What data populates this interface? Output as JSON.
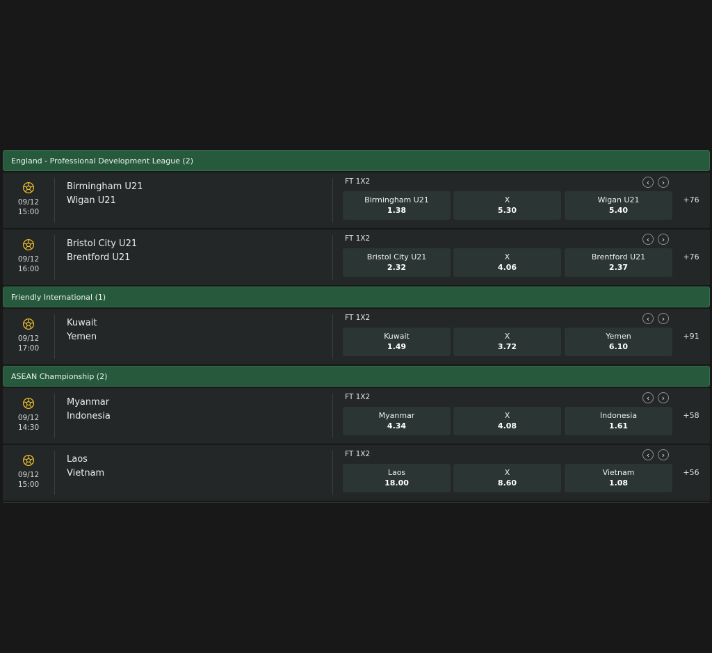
{
  "market_label": "FT 1X2",
  "draw_label": "X",
  "colors": {
    "accent": "#f2c02e",
    "header_bg": "#275a3d",
    "row_bg": "#232727",
    "odd_bg": "#2b3533"
  },
  "icons": {
    "sport": "soccer-ball-icon",
    "prev": "chevron-left-icon",
    "next": "chevron-right-icon"
  },
  "leagues": [
    {
      "title": "England - Professional Development League (2)",
      "events": [
        {
          "date": "09/12",
          "time": "15:00",
          "home": "Birmingham U21",
          "away": "Wigan U21",
          "odds": [
            {
              "label": "Birmingham U21",
              "value": "1.38"
            },
            {
              "label": "X",
              "value": "5.30"
            },
            {
              "label": "Wigan U21",
              "value": "5.40"
            }
          ],
          "more": "+76"
        },
        {
          "date": "09/12",
          "time": "16:00",
          "home": "Bristol City U21",
          "away": "Brentford U21",
          "odds": [
            {
              "label": "Bristol City U21",
              "value": "2.32"
            },
            {
              "label": "X",
              "value": "4.06"
            },
            {
              "label": "Brentford U21",
              "value": "2.37"
            }
          ],
          "more": "+76"
        }
      ]
    },
    {
      "title": "Friendly International (1)",
      "events": [
        {
          "date": "09/12",
          "time": "17:00",
          "home": "Kuwait",
          "away": "Yemen",
          "odds": [
            {
              "label": "Kuwait",
              "value": "1.49"
            },
            {
              "label": "X",
              "value": "3.72"
            },
            {
              "label": "Yemen",
              "value": "6.10"
            }
          ],
          "more": "+91"
        }
      ]
    },
    {
      "title": "ASEAN Championship (2)",
      "events": [
        {
          "date": "09/12",
          "time": "14:30",
          "home": "Myanmar",
          "away": "Indonesia",
          "odds": [
            {
              "label": "Myanmar",
              "value": "4.34"
            },
            {
              "label": "X",
              "value": "4.08"
            },
            {
              "label": "Indonesia",
              "value": "1.61"
            }
          ],
          "more": "+58"
        },
        {
          "date": "09/12",
          "time": "15:00",
          "home": "Laos",
          "away": "Vietnam",
          "odds": [
            {
              "label": "Laos",
              "value": "18.00"
            },
            {
              "label": "X",
              "value": "8.60"
            },
            {
              "label": "Vietnam",
              "value": "1.08"
            }
          ],
          "more": "+56"
        }
      ]
    }
  ]
}
